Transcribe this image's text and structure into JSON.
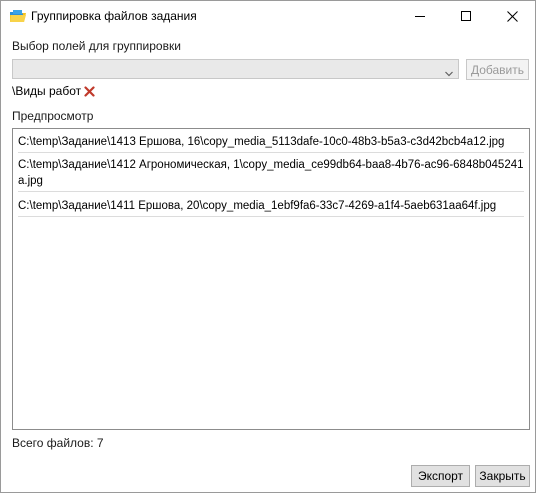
{
  "window": {
    "title": "Группировка файлов задания"
  },
  "fields": {
    "label": "Выбор полей для группировки",
    "selected_value": "",
    "add_label": "Добавить",
    "tags": [
      {
        "label": "\\Виды работ"
      }
    ]
  },
  "preview": {
    "label": "Предпросмотр",
    "items": [
      "C:\\temp\\Задание\\1413 Ершова, 16\\copy_media_5113dafe-10c0-48b3-b5a3-c3d42bcb4a12.jpg",
      "C:\\temp\\Задание\\1412 Агрономическая, 1\\copy_media_ce99db64-baa8-4b76-ac96-6848b045241a.jpg",
      "C:\\temp\\Задание\\1411 Ершова, 20\\copy_media_1ebf9fa6-33c7-4269-a1f4-5aeb631aa64f.jpg"
    ]
  },
  "footer": {
    "total_label": "Всего файлов: 7",
    "export_label": "Экспорт",
    "close_label": "Закрыть"
  },
  "colors": {
    "disabled_text": "#9a9a9a",
    "remove_icon": "#c0392b",
    "button_bg": "#e1e1e1"
  },
  "icons": {
    "app": "folder-icon",
    "minimize": "minimize-icon",
    "maximize": "maximize-icon",
    "close": "close-icon",
    "dropdown": "chevron-down-icon",
    "remove": "remove-x-icon"
  }
}
